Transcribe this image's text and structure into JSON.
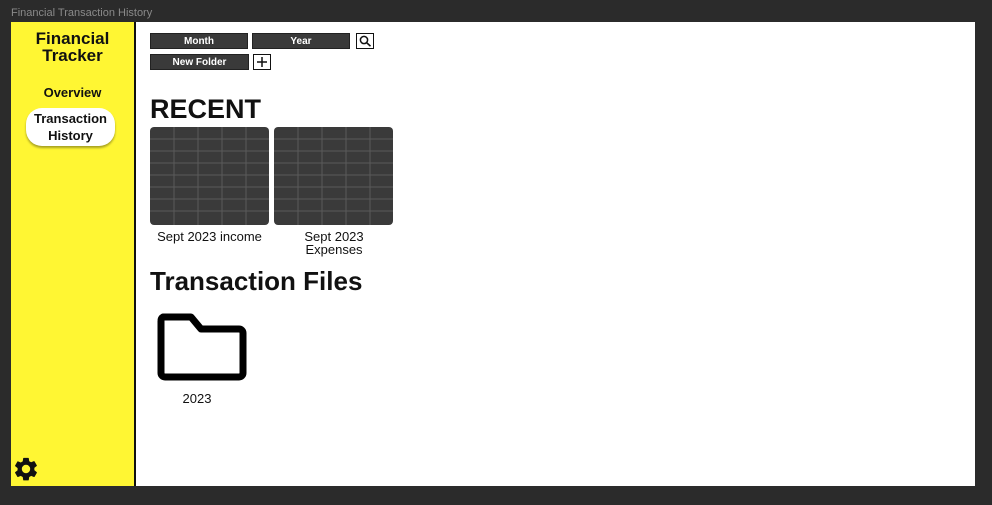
{
  "window": {
    "title": "Financial Transaction History"
  },
  "sidebar": {
    "brand": "Financial Tracker",
    "items": [
      {
        "label": "Overview",
        "active": false
      },
      {
        "label": "Transaction History",
        "active": true
      }
    ],
    "settings_icon": "gear-icon"
  },
  "toolbar": {
    "month_label": "Month",
    "year_label": "Year",
    "search_icon": "search-icon",
    "new_folder_label": "New Folder",
    "add_icon": "plus-icon"
  },
  "recent": {
    "heading": "RECENT",
    "files": [
      {
        "name": "Sept 2023 income"
      },
      {
        "name": "Sept 2023 Expenses"
      }
    ]
  },
  "transaction_files": {
    "heading": "Transaction Files",
    "folders": [
      {
        "name": "2023",
        "icon": "folder-icon"
      }
    ]
  },
  "colors": {
    "sidebar": "#fff633",
    "accent_dark": "#3a3a3a",
    "background": "#2b2b2b"
  }
}
